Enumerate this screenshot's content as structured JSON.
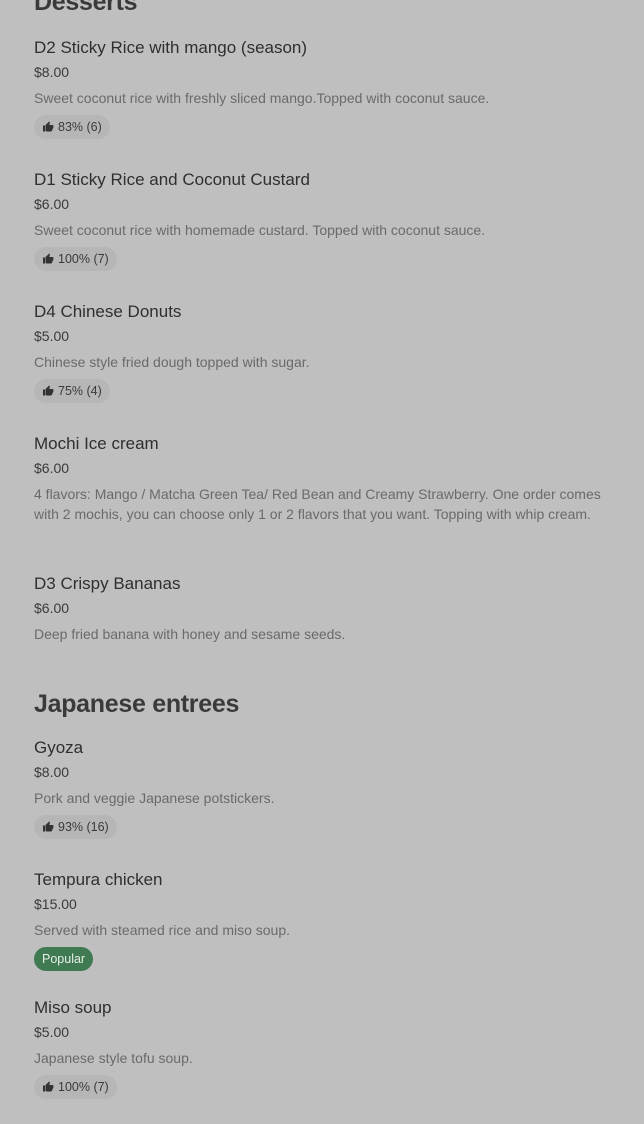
{
  "sections": [
    {
      "title": "Desserts",
      "items": [
        {
          "name": "D2 Sticky Rice with mango (season)",
          "price": "$8.00",
          "description": "Sweet coconut rice with freshly sliced mango.Topped with coconut sauce.",
          "badge": "83% (6)"
        },
        {
          "name": "D1 Sticky Rice and Coconut Custard",
          "price": "$6.00",
          "description": "Sweet coconut rice with homemade custard. Topped with coconut sauce.",
          "badge": "100% (7)"
        },
        {
          "name": "D4 Chinese Donuts",
          "price": "$5.00",
          "description": "Chinese style fried dough topped with sugar.",
          "badge": "75% (4)"
        },
        {
          "name": "Mochi Ice cream",
          "price": "$6.00",
          "description": "4 flavors: Mango / Matcha Green Tea/ Red Bean and Creamy Strawberry. One order comes with 2 mochis, you can choose only 1 or 2 flavors that you want. Topping with whip cream."
        },
        {
          "name": "D3 Crispy Bananas",
          "price": "$6.00",
          "description": "Deep fried banana with honey and sesame seeds."
        }
      ]
    },
    {
      "title": "Japanese entrees",
      "items": [
        {
          "name": "Gyoza",
          "price": "$8.00",
          "description": "Pork and veggie Japanese potstickers.",
          "badge": "93% (16)"
        },
        {
          "name": "Tempura chicken",
          "price": "$15.00",
          "description": "Served with steamed rice and miso soup.",
          "popular": "Popular"
        },
        {
          "name": "Miso soup",
          "price": "$5.00",
          "description": "Japanese style tofu soup.",
          "badge": "100% (7)"
        }
      ]
    }
  ]
}
